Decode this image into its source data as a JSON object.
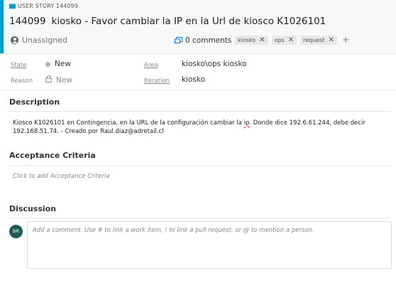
{
  "header": {
    "type_label": "USER STORY 144099",
    "id": "144099",
    "title": "kiosko  - Favor cambiar la IP en la Url de kiosco K1026101",
    "assignee": "Unassigned",
    "comments_label": "0 comments",
    "tags": [
      "kiosko",
      "ops",
      "request"
    ],
    "add_tag_glyph": "+"
  },
  "fields": {
    "state_label": "State",
    "state_value": "New",
    "reason_label": "Reason",
    "reason_value": "New",
    "area_label": "Area",
    "area_value": "kiosko\\ops kiosko",
    "iteration_label": "Iteration",
    "iteration_value": "kiosko"
  },
  "description": {
    "title": "Description",
    "text_before": "Kiosco K1026101 en Contingencia, en la URL de la configuración cambiar la ",
    "text_spell": "ip",
    "text_after": ". Donde dice 192.6.61.244, debe decir 192.168.51.74. - Creado por Raul.diaz@adretail.cl"
  },
  "acceptance": {
    "title": "Acceptance Criteria",
    "placeholder": "Click to add Acceptance Criteria"
  },
  "discussion": {
    "title": "Discussion",
    "avatar_initials": "BR",
    "placeholder": "Add a comment. Use # to link a work item, ! to link a pull request, or @ to mention a person."
  },
  "colors": {
    "accent": "#009ccc",
    "avatar": "#1e5a5a",
    "state_dot": "#b2b2b2",
    "link": "#0078d4"
  }
}
